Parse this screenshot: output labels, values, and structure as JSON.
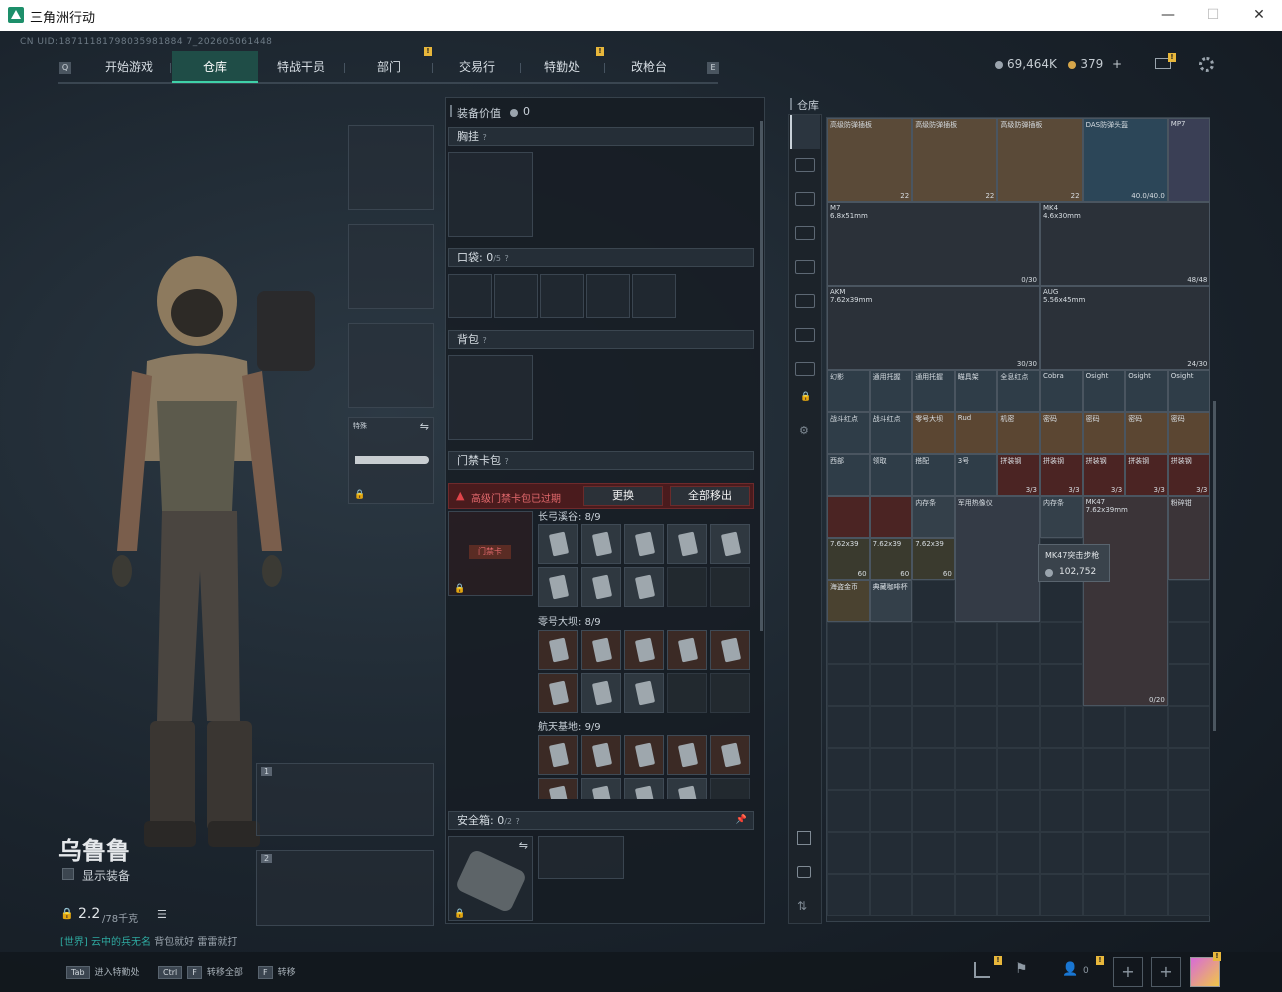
{
  "window": {
    "title": "三角洲行动",
    "minimize": "—",
    "maximize": "☐",
    "close": "✕"
  },
  "uid": "CN UID:18711181798035981884 7_202605061448",
  "nav": {
    "tabs": [
      "开始游戏",
      "仓库",
      "特战干员",
      "部门",
      "交易行",
      "特勤处",
      "改枪台"
    ],
    "active": "仓库",
    "left_key": "Q",
    "right_key": "E"
  },
  "currency": {
    "silver": "69,464K",
    "gold": "379",
    "plus": "+"
  },
  "operator": {
    "name": "乌鲁鲁",
    "show_gear": "显示装备",
    "weight": "2.2",
    "weight_max": "/78千克",
    "chat_channel": "[世界]",
    "chat_user": "云中的兵无名",
    "chat_msg": "背包就好 雷雷就打"
  },
  "equipment": {
    "value_label": "装备价值",
    "value": "0",
    "chest_rig": "胸挂",
    "pockets": "口袋:",
    "pockets_count": "0",
    "pockets_max": "/5",
    "backpack": "背包",
    "keycard_pack": "门禁卡包",
    "expired_warning": "高级门禁卡包已过期",
    "replace": "更换",
    "move_all": "全部移出",
    "keycard_item": "门禁卡",
    "zones": [
      {
        "name": "长弓溪谷",
        "count": "8/9"
      },
      {
        "name": "零号大坝",
        "count": "8/9"
      },
      {
        "name": "航天基地",
        "count": "9/9"
      }
    ],
    "secure_case": "安全箱:",
    "secure_count": "0",
    "secure_max": "/2",
    "melee_label": "特殊",
    "slot1": "1",
    "slot2": "2"
  },
  "stash": {
    "title": "仓库",
    "items": [
      {
        "name": "高级防弹插板",
        "count": "22"
      },
      {
        "name": "高级防弹插板",
        "count": "22"
      },
      {
        "name": "高级防弹插板",
        "count": "22"
      },
      {
        "name": "DAS防弹头盔",
        "count": "40.0/40.0"
      },
      {
        "name": "MP7",
        "count": ""
      },
      {
        "name": "M7",
        "sub": "6.8x51mm",
        "count": "0/30"
      },
      {
        "name": "MK4",
        "sub": "4.6x30mm",
        "count": "48/48"
      },
      {
        "name": "AKM",
        "sub": "7.62x39mm",
        "count": "30/30"
      },
      {
        "name": "AUG",
        "sub": "5.56x45mm",
        "count": "24/30"
      },
      {
        "name": "MK47",
        "sub": "7.62x39mm",
        "count": "0/20"
      }
    ],
    "scopes": [
      "幻影",
      "通用托握",
      "通用托握",
      "瞄具架",
      "全息红点",
      "Cobra",
      "Osight",
      "Osight",
      "Osight"
    ],
    "row2": [
      "战斗红点",
      "战斗红点",
      "零号大坝",
      "Rud",
      "机密",
      "密码",
      "密码",
      "密码",
      "密码"
    ],
    "row3": [
      "西部",
      "领取",
      "搭配",
      "3号",
      "拼装钢",
      "拼装钢",
      "拼装钢",
      "拼装钢",
      "拼装钢"
    ],
    "row3_counts": [
      "",
      "",
      "",
      "",
      "3/3",
      "3/3",
      "3/3",
      "3/3",
      "3/3"
    ],
    "ammo": [
      "7.62x39",
      "7.62x39",
      "7.62x39"
    ],
    "ammo_counts": [
      "60",
      "60",
      "60"
    ],
    "misc": [
      "海盗金币",
      "典藏咖啡杯",
      "内存条",
      "军用热像仪",
      "内存条",
      "粉碎钳"
    ],
    "tooltip": {
      "name": "MK47突击步枪",
      "value": "102,752"
    }
  },
  "bottom": {
    "hints": [
      {
        "key": "Tab",
        "label": "进入特勤处"
      },
      {
        "key": "Ctrl",
        "key2": "F",
        "label": "转移全部"
      },
      {
        "key": "F",
        "label": "转移"
      }
    ],
    "friends": "0"
  },
  "colors": {
    "accent": "#3fd1a8",
    "warning": "#e0444a",
    "badge": "#e8b73b"
  }
}
